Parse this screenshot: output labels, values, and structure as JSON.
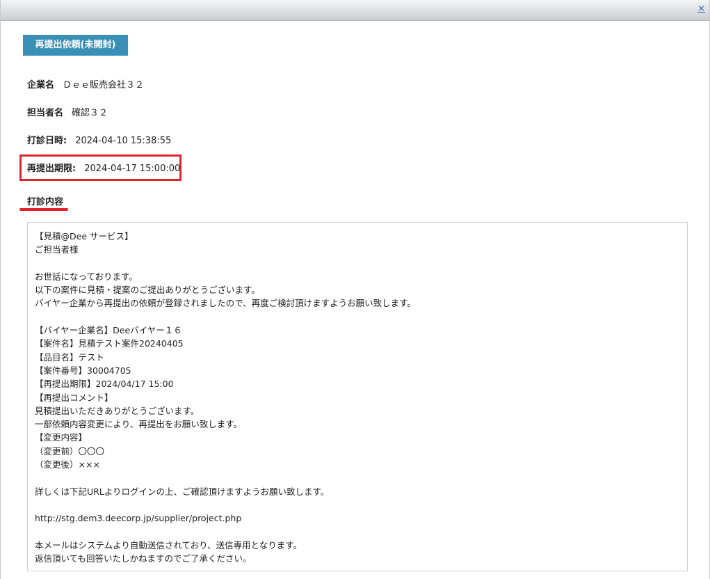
{
  "window": {
    "close_label": "×"
  },
  "status_button": {
    "label": "再提出依頼(未開封)"
  },
  "fields": [
    {
      "label": "企業名",
      "value": "Ｄｅｅ販売会社３２"
    },
    {
      "label": "担当者名",
      "value": "確認３２"
    },
    {
      "label": "打診日時:",
      "value": "2024-04-10 15:38:55"
    },
    {
      "label": "再提出期限:",
      "value": "2024-04-17 15:00:00"
    }
  ],
  "section": {
    "title": "打診内容"
  },
  "message": {
    "lines": [
      "【見積@Dee サービス】",
      "ご担当者様",
      "",
      "お世話になっております。",
      "以下の案件に見積・提案のご提出ありがとうございます。",
      "バイヤー企業から再提出の依頼が登録されましたので、再度ご検討頂けますようお願い致します。",
      "",
      "【バイヤー企業名】Deeバイヤー１６",
      "【案件名】見積テスト案件20240405",
      "【品目名】テスト",
      "【案件番号】30004705",
      "【再提出期限】2024/04/17 15:00",
      "【再提出コメント】",
      "見積提出いただきありがとうございます。",
      "一部依頼内容変更により、再提出をお願い致します。",
      "【変更内容】",
      "（変更前）〇〇〇",
      "（変更後）×××",
      "",
      "詳しくは下記URLよりログインの上、ご確認頂けますようお願い致します。",
      "",
      "http://stg.dem3.deecorp.jp/supplier/project.php",
      "",
      "本メールはシステムより自動送信されており、送信専用となります。",
      "返信頂いても回答いたしかねますのでご了承ください。"
    ]
  },
  "colors": {
    "accent_button": "#3a8fb7",
    "highlight_red": "#e0242f",
    "link_blue": "#2a5db0"
  }
}
